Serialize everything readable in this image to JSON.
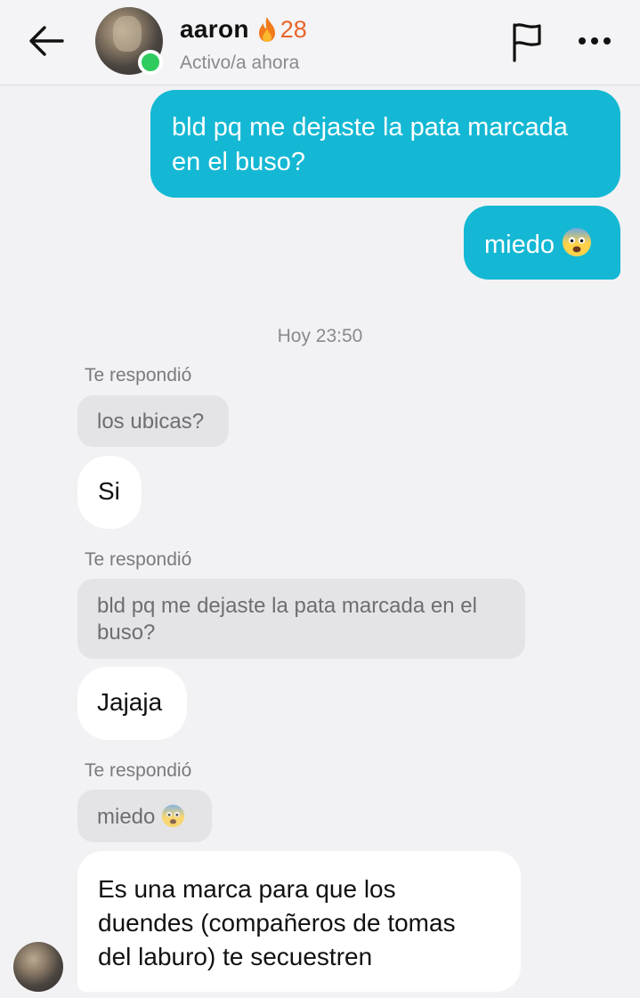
{
  "header": {
    "contact_name": "aaron",
    "streak_count": "28",
    "status": "Activo/a ahora",
    "icons": [
      "back-arrow-icon",
      "avatar",
      "online-dot",
      "fire-icon",
      "flag-icon",
      "more-icon"
    ],
    "colors": {
      "online": "#2fcb5e",
      "streak": "#e8642a"
    }
  },
  "colors": {
    "sent_bubble": "#14b8d4",
    "received_bubble": "#ffffff",
    "reply_quote": "#e4e4e6",
    "background": "#f2f2f4"
  },
  "sent_messages": [
    {
      "lines": [
        "bld pq me dejaste la pata marcada",
        "en el buso?"
      ]
    },
    {
      "text": "miedo",
      "emoji": "fearful-face"
    }
  ],
  "timestamp": "Hoy 23:50",
  "reply_label": "Te respondió",
  "replies": [
    {
      "quoted": "los ubicas?",
      "message": "Si"
    },
    {
      "quoted_lines": [
        "bld pq me dejaste la pata marcada en el",
        "buso?"
      ],
      "message": "Jajaja"
    },
    {
      "quoted": "miedo",
      "quoted_emoji": "fearful-face",
      "message_lines": [
        "Es una marca para que los",
        "duendes (compañeros de tomas",
        "del laburo) te secuestren"
      ]
    }
  ]
}
